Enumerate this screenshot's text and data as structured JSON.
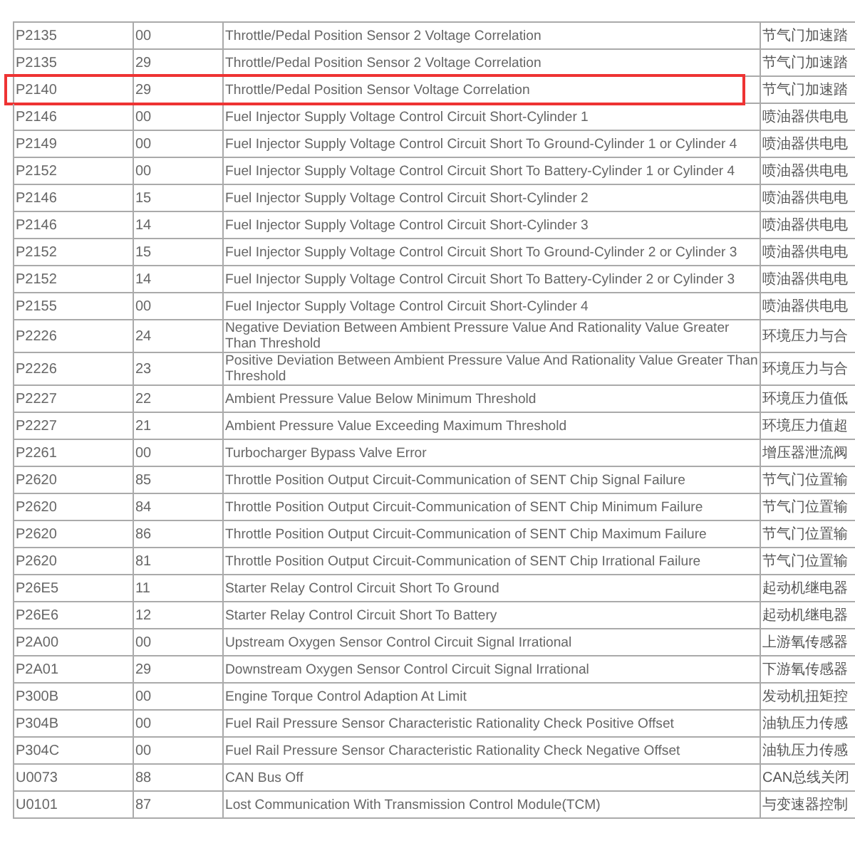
{
  "table": {
    "rows": [
      {
        "code": "P2135",
        "sub": "00",
        "description": "Throttle/Pedal Position Sensor 2 Voltage Correlation",
        "chinese": "节气门加速踏",
        "highlighted": false
      },
      {
        "code": "P2135",
        "sub": "29",
        "description": "Throttle/Pedal Position Sensor 2 Voltage Correlation",
        "chinese": "节气门加速踏",
        "highlighted": false
      },
      {
        "code": "P2140",
        "sub": "29",
        "description": "Throttle/Pedal Position Sensor Voltage Correlation",
        "chinese": "节气门加速踏",
        "highlighted": true
      },
      {
        "code": "P2146",
        "sub": "00",
        "description": "Fuel Injector Supply Voltage Control Circuit Short-Cylinder 1",
        "chinese": "喷油器供电电",
        "highlighted": false
      },
      {
        "code": "P2149",
        "sub": "00",
        "description": "Fuel Injector Supply Voltage Control Circuit Short To Ground-Cylinder 1 or Cylinder 4",
        "chinese": "喷油器供电电",
        "highlighted": false
      },
      {
        "code": "P2152",
        "sub": "00",
        "description": "Fuel Injector Supply Voltage Control Circuit Short To Battery-Cylinder 1 or Cylinder 4",
        "chinese": "喷油器供电电",
        "highlighted": false
      },
      {
        "code": "P2146",
        "sub": "15",
        "description": "Fuel Injector Supply Voltage Control Circuit Short-Cylinder 2",
        "chinese": "喷油器供电电",
        "highlighted": false
      },
      {
        "code": "P2146",
        "sub": "14",
        "description": "Fuel Injector Supply Voltage Control Circuit Short-Cylinder 3",
        "chinese": "喷油器供电电",
        "highlighted": false
      },
      {
        "code": "P2152",
        "sub": "15",
        "description": "Fuel Injector Supply Voltage Control Circuit Short To Ground-Cylinder 2 or Cylinder 3",
        "chinese": "喷油器供电电",
        "highlighted": false
      },
      {
        "code": "P2152",
        "sub": "14",
        "description": "Fuel Injector Supply Voltage Control Circuit Short To Battery-Cylinder 2 or Cylinder 3",
        "chinese": "喷油器供电电",
        "highlighted": false
      },
      {
        "code": "P2155",
        "sub": "00",
        "description": "Fuel Injector Supply Voltage Control Circuit Short-Cylinder 4",
        "chinese": "喷油器供电电",
        "highlighted": false
      },
      {
        "code": "P2226",
        "sub": "24",
        "description": "Negative Deviation Between Ambient Pressure Value And Rationality Value Greater Than Threshold",
        "chinese": "环境压力与合",
        "highlighted": false
      },
      {
        "code": "P2226",
        "sub": "23",
        "description": "Positive Deviation Between Ambient Pressure Value And Rationality Value Greater Than Threshold",
        "chinese": "环境压力与合",
        "highlighted": false
      },
      {
        "code": "P2227",
        "sub": "22",
        "description": "Ambient Pressure Value Below Minimum Threshold",
        "chinese": "环境压力值低",
        "highlighted": false
      },
      {
        "code": "P2227",
        "sub": "21",
        "description": "Ambient Pressure Value Exceeding Maximum Threshold",
        "chinese": "环境压力值超",
        "highlighted": false
      },
      {
        "code": "P2261",
        "sub": "00",
        "description": "Turbocharger Bypass Valve Error",
        "chinese": "增压器泄流阀",
        "highlighted": false
      },
      {
        "code": "P2620",
        "sub": "85",
        "description": "Throttle Position Output Circuit-Communication of SENT Chip Signal Failure",
        "chinese": "节气门位置输",
        "highlighted": false
      },
      {
        "code": "P2620",
        "sub": "84",
        "description": "Throttle Position Output Circuit-Communication of SENT Chip Minimum Failure",
        "chinese": "节气门位置输",
        "highlighted": false
      },
      {
        "code": "P2620",
        "sub": "86",
        "description": "Throttle Position Output Circuit-Communication of SENT Chip Maximum Failure",
        "chinese": "节气门位置输",
        "highlighted": false
      },
      {
        "code": "P2620",
        "sub": "81",
        "description": "Throttle Position Output Circuit-Communication of SENT Chip Irrational Failure",
        "chinese": "节气门位置输",
        "highlighted": false
      },
      {
        "code": "P26E5",
        "sub": "11",
        "description": "Starter Relay Control Circuit Short To Ground",
        "chinese": "起动机继电器",
        "highlighted": false
      },
      {
        "code": "P26E6",
        "sub": "12",
        "description": "Starter Relay Control Circuit Short To Battery",
        "chinese": "起动机继电器",
        "highlighted": false
      },
      {
        "code": "P2A00",
        "sub": "00",
        "description": "Upstream Oxygen Sensor Control Circuit Signal Irrational",
        "chinese": "上游氧传感器",
        "highlighted": false
      },
      {
        "code": "P2A01",
        "sub": "29",
        "description": "Downstream Oxygen Sensor Control Circuit Signal Irrational",
        "chinese": "下游氧传感器",
        "highlighted": false
      },
      {
        "code": "P300B",
        "sub": "00",
        "description": "Engine Torque Control Adaption At Limit",
        "chinese": "发动机扭矩控",
        "highlighted": false
      },
      {
        "code": "P304B",
        "sub": "00",
        "description": "Fuel Rail Pressure Sensor Characteristic Rationality Check Positive Offset",
        "chinese": "油轨压力传感",
        "highlighted": false
      },
      {
        "code": "P304C",
        "sub": "00",
        "description": "Fuel Rail Pressure Sensor Characteristic Rationality Check Negative Offset",
        "chinese": "油轨压力传感",
        "highlighted": false
      },
      {
        "code": "U0073",
        "sub": "88",
        "description": "CAN Bus Off",
        "chinese": "CAN总线关闭",
        "highlighted": false
      },
      {
        "code": "U0101",
        "sub": "87",
        "description": "Lost Communication With Transmission Control Module(TCM)",
        "chinese": "与变速器控制",
        "highlighted": false
      }
    ]
  }
}
